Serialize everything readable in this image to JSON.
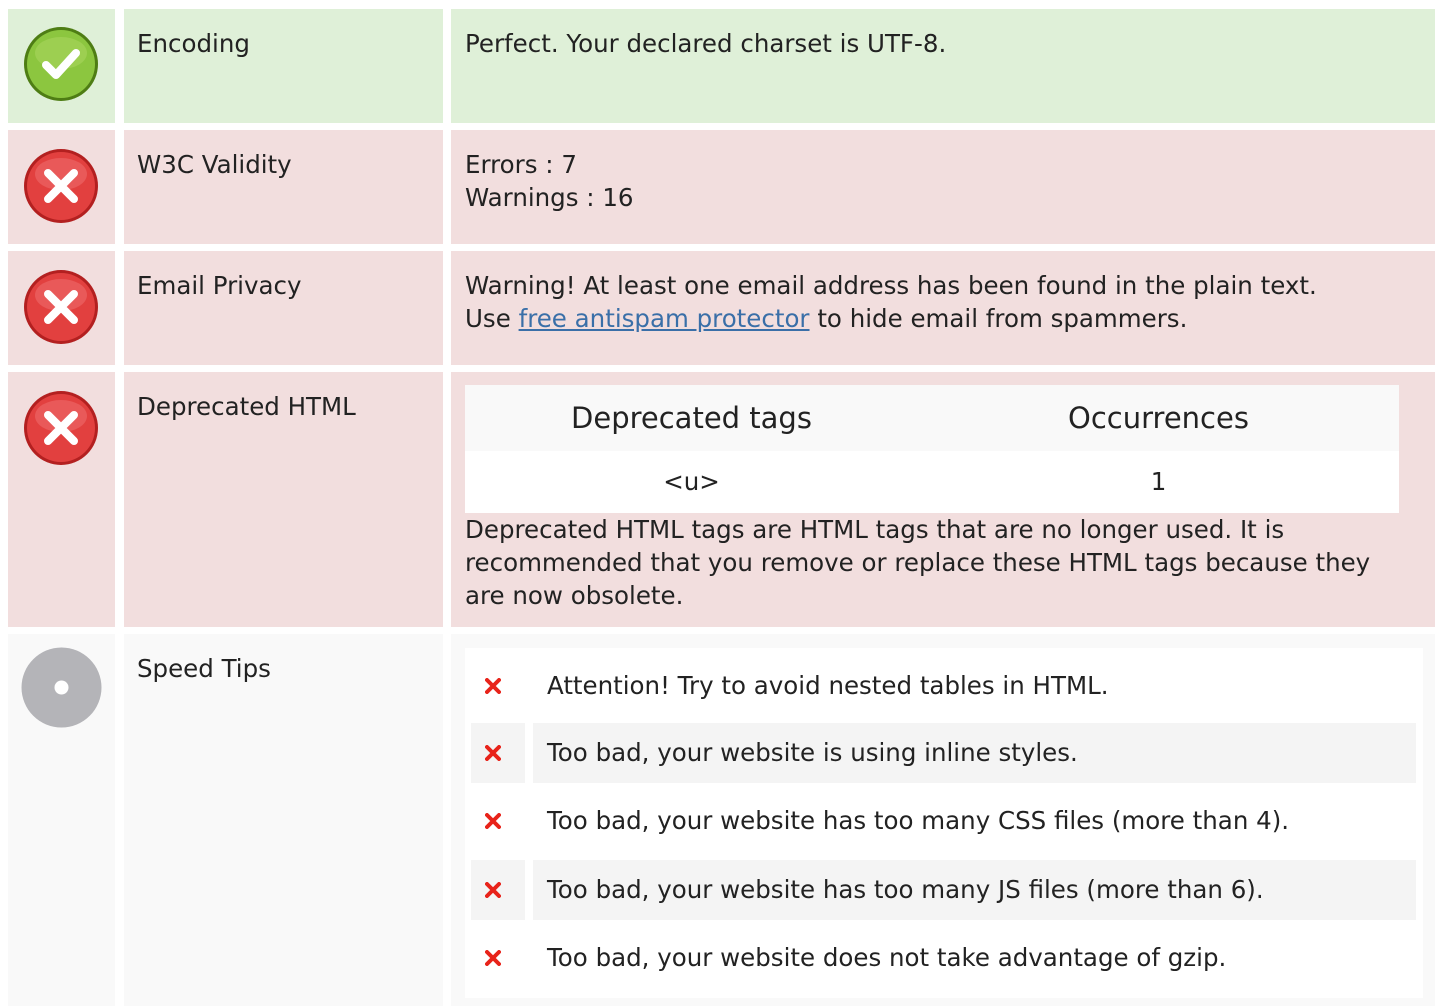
{
  "colors": {
    "pass_bg": "#dff0d8",
    "fail_bg": "#f2dede",
    "neutral_bg": "#f9f9f9",
    "link": "#3a6fa8",
    "tip_mark": "#e8231a"
  },
  "rows": {
    "encoding": {
      "status_icon": "check-circle-icon",
      "label": "Encoding",
      "text": "Perfect. Your declared charset is UTF-8."
    },
    "w3c": {
      "status_icon": "x-circle-icon",
      "label": "W3C Validity",
      "errors": "Errors : 7",
      "warnings": "Warnings : 16"
    },
    "email": {
      "status_icon": "x-circle-icon",
      "label": "Email Privacy",
      "text_line1": "Warning! At least one email address has been found in the plain text.",
      "text_pre": "Use",
      "link": "free antispam protector",
      "text_post": "to hide email from spammers."
    },
    "deprecated": {
      "status_icon": "x-circle-icon",
      "label": "Deprecated HTML",
      "table": {
        "headers": [
          "Deprecated tags",
          "Occurrences"
        ],
        "rows": [
          [
            "<u>",
            "1"
          ]
        ]
      },
      "note": "Deprecated HTML tags are HTML tags that are no longer used. It is recommended that you remove or replace these HTML tags because they are now obsolete."
    },
    "speed": {
      "status_icon": "neutral-circle-icon",
      "label": "Speed Tips",
      "tips": [
        "Attention! Try to avoid nested tables in HTML.",
        "Too bad, your website is using inline styles.",
        "Too bad, your website has too many CSS files (more than 4).",
        "Too bad, your website has too many JS files (more than 6).",
        "Too bad, your website does not take advantage of gzip."
      ]
    }
  }
}
